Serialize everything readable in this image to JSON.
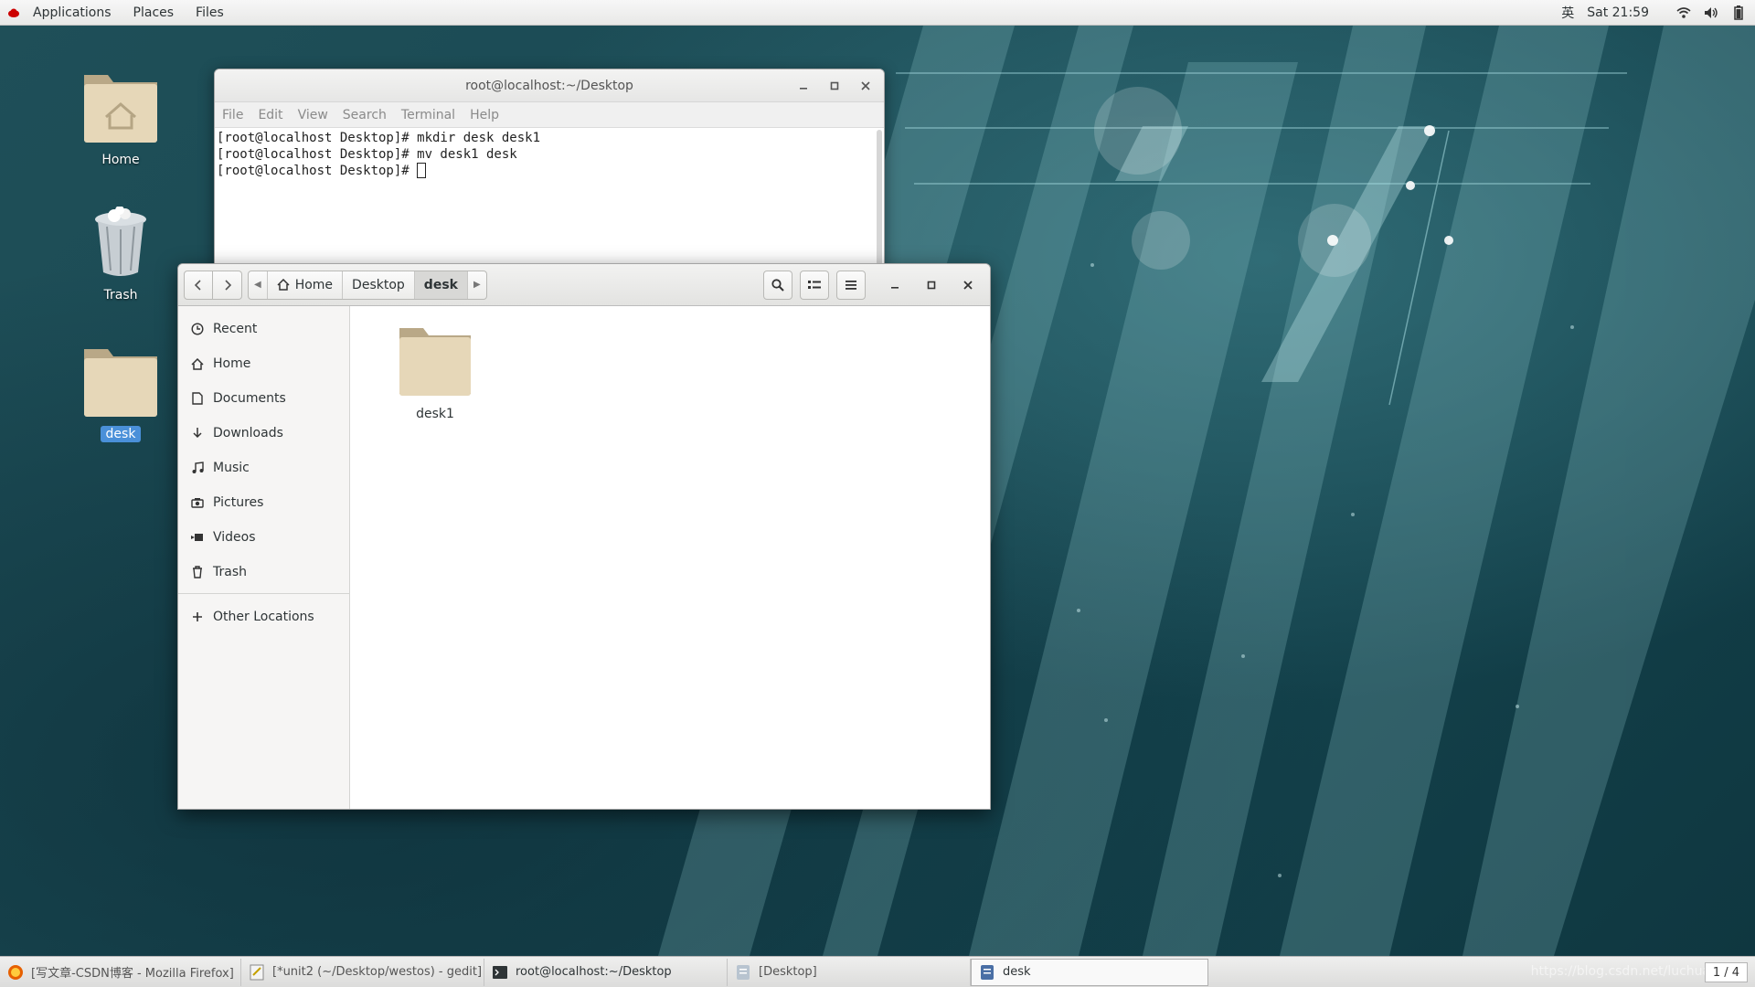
{
  "topbar": {
    "applications": "Applications",
    "places": "Places",
    "files": "Files",
    "input_method": "英",
    "clock": "Sat 21:59"
  },
  "desktop": {
    "icons": [
      {
        "label": "Home"
      },
      {
        "label": "Trash"
      },
      {
        "label": "desk"
      }
    ]
  },
  "terminal": {
    "title": "root@localhost:~/Desktop",
    "menu": [
      "File",
      "Edit",
      "View",
      "Search",
      "Terminal",
      "Help"
    ],
    "lines": [
      "[root@localhost Desktop]# mkdir desk desk1",
      "[root@localhost Desktop]# mv desk1 desk",
      "[root@localhost Desktop]# "
    ]
  },
  "files": {
    "path": [
      "Home",
      "Desktop",
      "desk"
    ],
    "sidebar": [
      {
        "label": "Recent",
        "icon": "clock-icon"
      },
      {
        "label": "Home",
        "icon": "home-icon"
      },
      {
        "label": "Documents",
        "icon": "document-icon"
      },
      {
        "label": "Downloads",
        "icon": "download-icon"
      },
      {
        "label": "Music",
        "icon": "music-icon"
      },
      {
        "label": "Pictures",
        "icon": "camera-icon"
      },
      {
        "label": "Videos",
        "icon": "video-icon"
      },
      {
        "label": "Trash",
        "icon": "trash-icon"
      }
    ],
    "other_locations": "Other Locations",
    "items": [
      {
        "name": "desk1",
        "type": "folder"
      }
    ]
  },
  "taskbar": {
    "tasks": [
      {
        "label": "[写文章-CSDN博客 - Mozilla Firefox]",
        "icon": "firefox-icon"
      },
      {
        "label": "[*unit2 (~/Desktop/westos) - gedit]",
        "icon": "gedit-icon"
      },
      {
        "label": "root@localhost:~/Desktop",
        "icon": "terminal-icon"
      },
      {
        "label": "[Desktop]",
        "icon": "files-icon"
      },
      {
        "label": "desk",
        "icon": "files-icon"
      }
    ],
    "watermark": "https://blog.csdn.net/luchuan",
    "workspace": "1 / 4"
  }
}
